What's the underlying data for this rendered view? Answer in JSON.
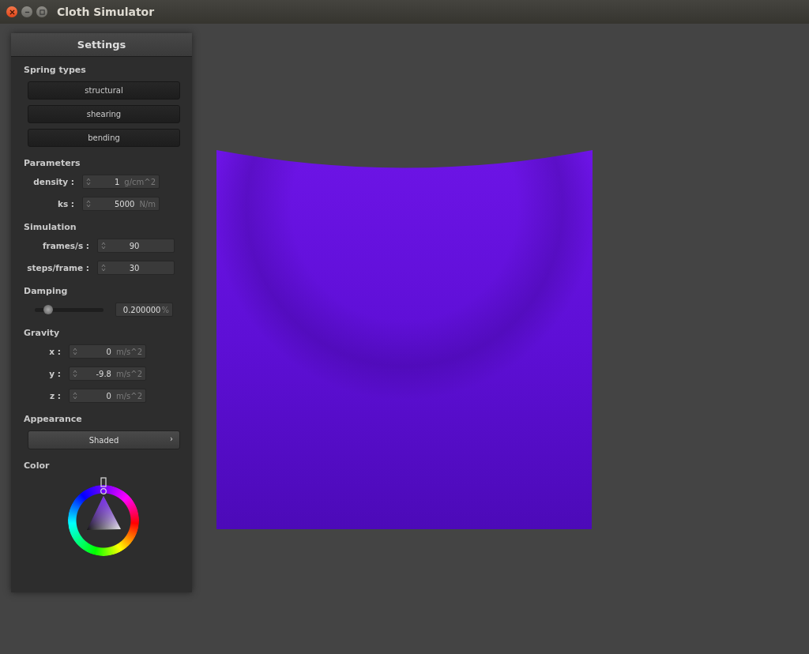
{
  "window": {
    "title": "Cloth Simulator"
  },
  "panel": {
    "title": "Settings",
    "sections": [
      {
        "kind": "buttons",
        "title": "Spring types",
        "buttons": [
          "structural",
          "shearing",
          "bending"
        ]
      },
      {
        "kind": "fields",
        "title": "Parameters",
        "fields": [
          {
            "label": "density :",
            "value": "1",
            "unit": "g/cm^2"
          },
          {
            "label": "ks :",
            "value": "5000",
            "unit": "N/m"
          }
        ]
      },
      {
        "kind": "fields",
        "title": "Simulation",
        "fields": [
          {
            "label": "frames/s :",
            "value": "90"
          },
          {
            "label": "steps/frame :",
            "value": "30"
          }
        ]
      },
      {
        "kind": "slider",
        "title": "Damping",
        "level": 0.2,
        "reading": "0.200000",
        "unit": "%"
      },
      {
        "kind": "fields",
        "title": "Gravity",
        "fields": [
          {
            "label": "x :",
            "value": "0",
            "unit": "m/s^2"
          },
          {
            "label": "y :",
            "value": "-9.8",
            "unit": "m/s^2"
          },
          {
            "label": "z :",
            "value": "0",
            "unit": "m/s^2"
          }
        ]
      },
      {
        "kind": "dropdown",
        "title": "Appearance",
        "value": "Shaded",
        "arrow": "›"
      },
      {
        "kind": "color",
        "title": "Color"
      }
    ]
  }
}
